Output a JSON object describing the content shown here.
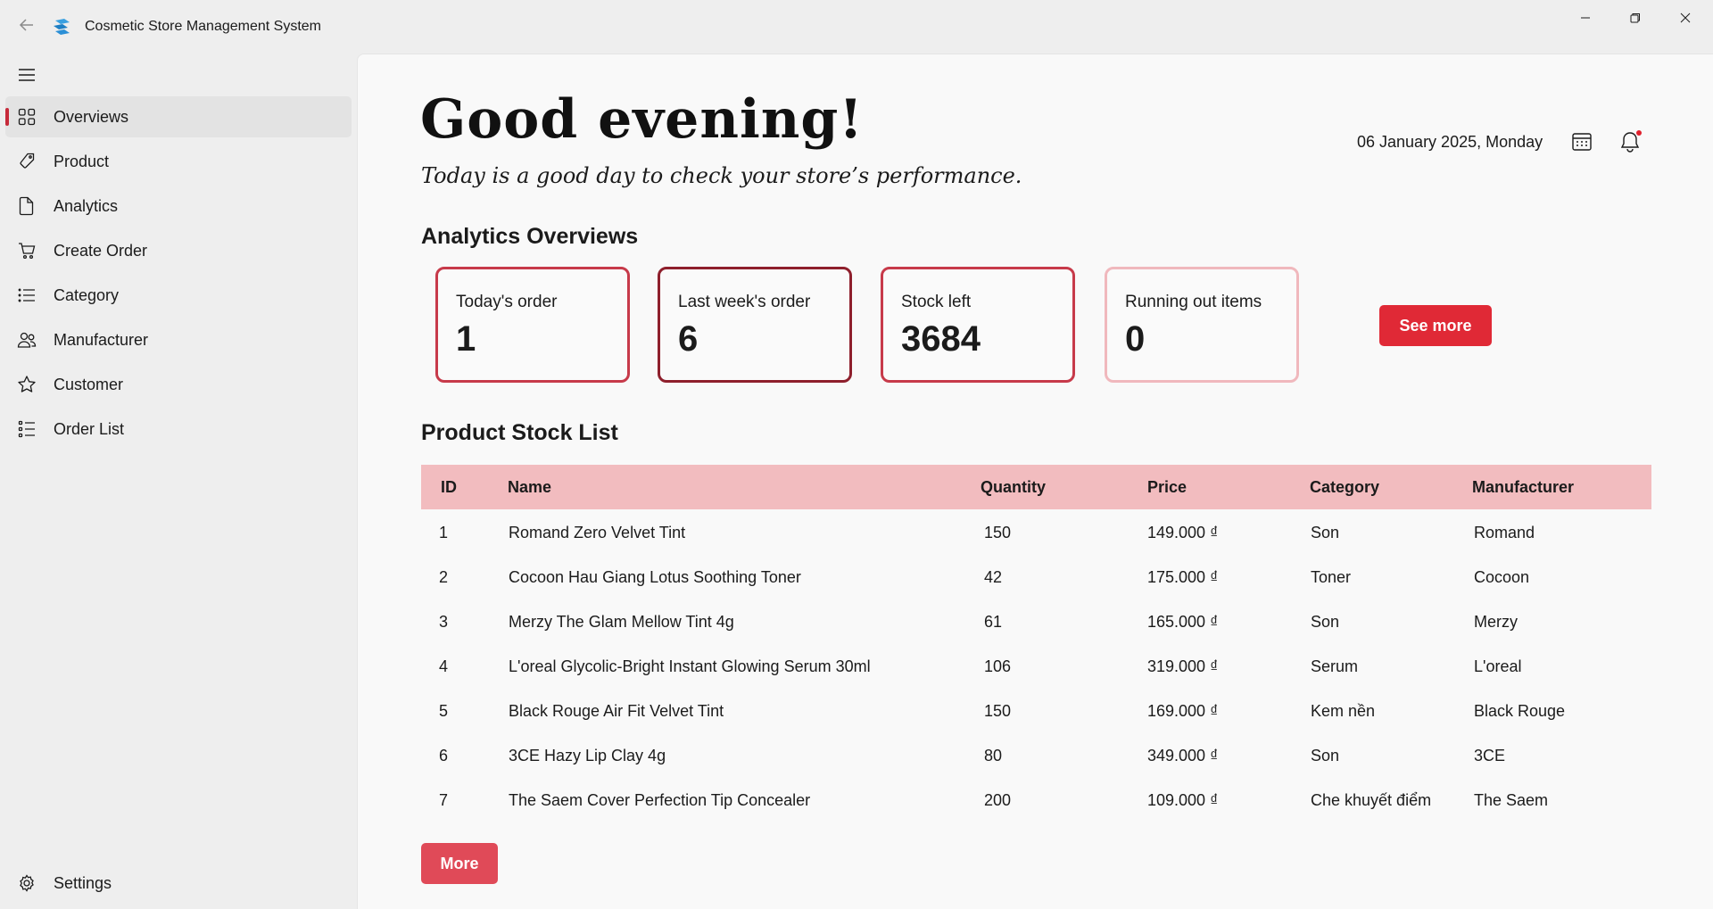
{
  "window": {
    "title": "Cosmetic Store Management System"
  },
  "sidebar": {
    "items": [
      {
        "label": "Overviews",
        "icon": "grid-icon",
        "active": true
      },
      {
        "label": "Product",
        "icon": "tag-icon"
      },
      {
        "label": "Analytics",
        "icon": "document-icon"
      },
      {
        "label": "Create Order",
        "icon": "cart-icon"
      },
      {
        "label": "Category",
        "icon": "list-icon"
      },
      {
        "label": "Manufacturer",
        "icon": "people-icon"
      },
      {
        "label": "Customer",
        "icon": "star-icon"
      },
      {
        "label": "Order List",
        "icon": "numbered-list-icon"
      }
    ],
    "settings_label": "Settings"
  },
  "header": {
    "greeting": "Good evening!",
    "subtitle": "Today is a good day to check your store’s performance.",
    "date": "06 January 2025, Monday"
  },
  "analytics": {
    "title": "Analytics Overviews",
    "cards": [
      {
        "label": "Today's order",
        "value": "1",
        "border": "#c73a4a"
      },
      {
        "label": "Last week's order",
        "value": "6",
        "border": "#8e1f2c"
      },
      {
        "label": "Stock left",
        "value": "3684",
        "border": "#c73a4a"
      },
      {
        "label": "Running out items",
        "value": "0",
        "border": "#f0b8bd"
      }
    ],
    "see_more_label": "See more"
  },
  "stock": {
    "title": "Product Stock List",
    "columns": [
      "ID",
      "Name",
      "Quantity",
      "Price",
      "Category",
      "Manufacturer"
    ],
    "rows": [
      [
        "1",
        "Romand Zero Velvet Tint",
        "150",
        "149.000 ₫",
        "Son",
        "Romand"
      ],
      [
        "2",
        "Cocoon Hau Giang Lotus Soothing Toner",
        "42",
        "175.000 ₫",
        "Toner",
        "Cocoon"
      ],
      [
        "3",
        "Merzy The Glam Mellow Tint 4g",
        "61",
        "165.000 ₫",
        "Son",
        "Merzy"
      ],
      [
        "4",
        "L'oreal Glycolic-Bright Instant Glowing Serum 30ml",
        "106",
        "319.000 ₫",
        "Serum",
        "L'oreal"
      ],
      [
        "5",
        "Black Rouge Air Fit Velvet Tint",
        "150",
        "169.000 ₫",
        "Kem nền",
        "Black Rouge"
      ],
      [
        "6",
        "3CE Hazy Lip Clay 4g",
        "80",
        "349.000 ₫",
        "Son",
        "3CE"
      ],
      [
        "7",
        "The Saem Cover Perfection Tip Concealer",
        "200",
        "109.000 ₫",
        "Che khuyết điểm",
        "The Saem"
      ]
    ],
    "more_label": "More"
  },
  "colors": {
    "accent": "#e02936",
    "header_row": "#f2bcbf",
    "active_indicator": "#c62a3a"
  }
}
